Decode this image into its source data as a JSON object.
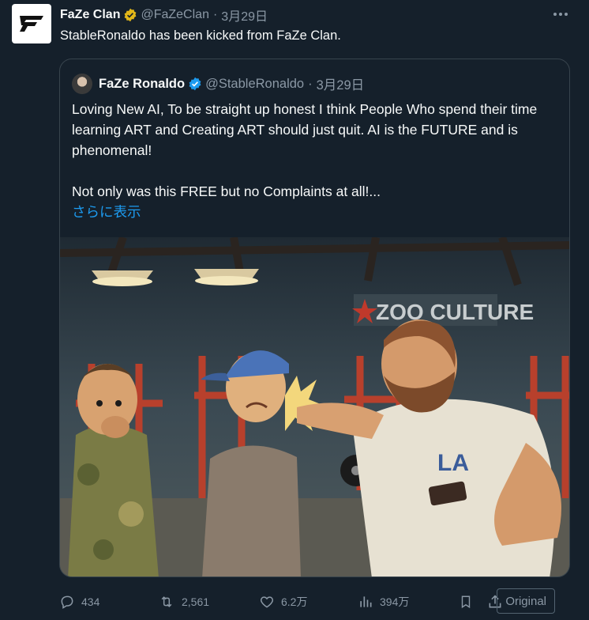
{
  "tweet": {
    "author_name": "FaZe Clan",
    "handle": "@FaZeClan",
    "date": "3月29日",
    "text": "StableRonaldo has been kicked from FaZe Clan."
  },
  "quoted": {
    "author_name": "FaZe Ronaldo",
    "handle": "@StableRonaldo",
    "date": "3月29日",
    "line1": "Loving New AI, To be straight up honest I think People Who spend their time learning ART and Creating ART should just quit. AI is the FUTURE and is phenomenal!",
    "line2": "Not only was this FREE but no Complaints at all!...",
    "show_more": "さらに表示",
    "image_sign": "ZOO CULTURE"
  },
  "actions": {
    "replies": "434",
    "retweets": "2,561",
    "likes": "6.2万",
    "views": "394万",
    "original_label": "Original"
  },
  "colors": {
    "background": "#15202b",
    "link": "#1d9bf0",
    "muted": "#8b98a5",
    "verified_gold": "#e2b719",
    "verified_blue": "#1d9bf0"
  },
  "icons": [
    "faze-logo",
    "gold-verified-badge",
    "blue-verified-badge",
    "more-icon",
    "reply-icon",
    "retweet-icon",
    "like-icon",
    "views-icon",
    "bookmark-icon",
    "share-icon"
  ]
}
